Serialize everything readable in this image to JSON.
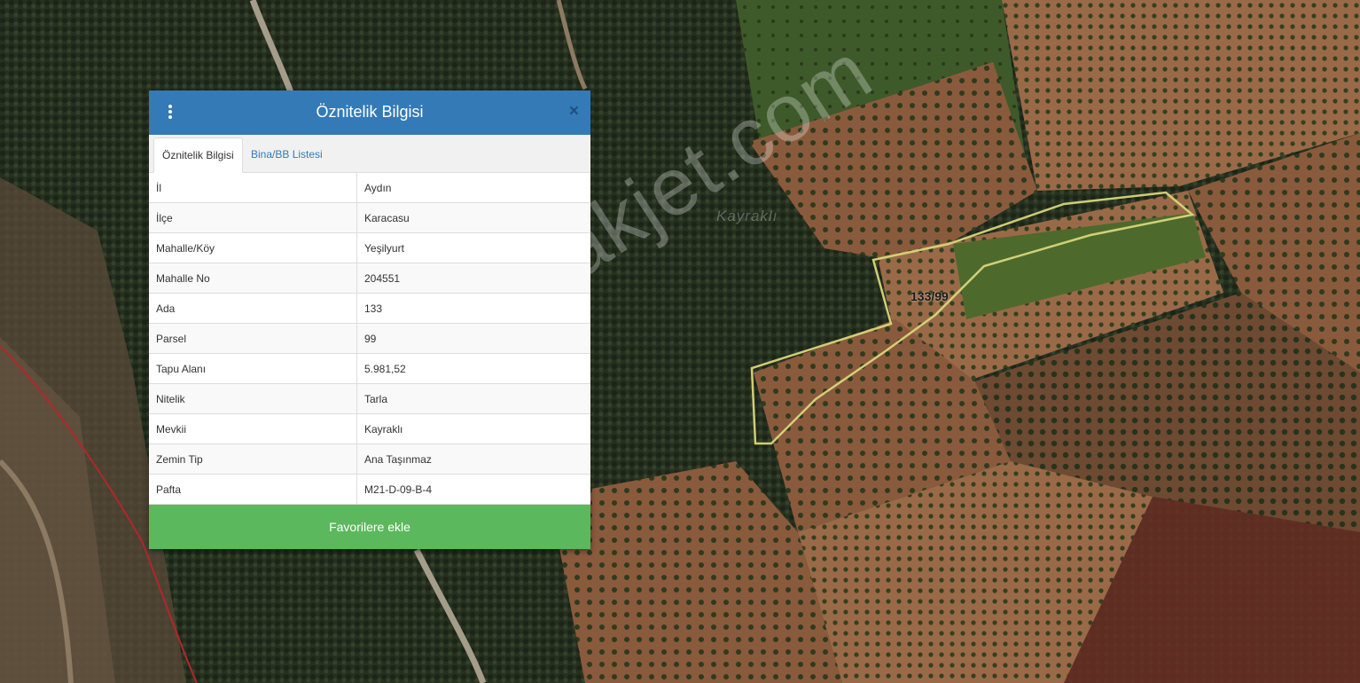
{
  "map": {
    "watermark": "emlakjet.com",
    "faint_label": "Kayraklı",
    "parcel_label": "133/99"
  },
  "panel": {
    "title": "Öznitelik Bilgisi",
    "close_glyph": "×",
    "tabs": [
      {
        "label": "Öznitelik Bilgisi",
        "active": true
      },
      {
        "label": "Bina/BB Listesi",
        "active": false
      }
    ],
    "rows": [
      {
        "key": "İl",
        "value": "Aydın"
      },
      {
        "key": "İlçe",
        "value": "Karacasu"
      },
      {
        "key": "Mahalle/Köy",
        "value": "Yeşilyurt"
      },
      {
        "key": "Mahalle No",
        "value": "204551"
      },
      {
        "key": "Ada",
        "value": "133"
      },
      {
        "key": "Parsel",
        "value": "99"
      },
      {
        "key": "Tapu Alanı",
        "value": "5.981,52"
      },
      {
        "key": "Nitelik",
        "value": "Tarla"
      },
      {
        "key": "Mevkii",
        "value": "Kayraklı"
      },
      {
        "key": "Zemin Tip",
        "value": "Ana Taşınmaz"
      },
      {
        "key": "Pafta",
        "value": "M21-D-09-B-4"
      }
    ],
    "favorite_button": "Favorilere ekle"
  },
  "colors": {
    "header": "#337ab7",
    "favorite_button": "#5cb85c",
    "parcel_outline": "#d8d67a",
    "boundary_line": "#b3262a"
  },
  "icons": {
    "menu": "vertical-dots-icon",
    "close": "close-icon"
  }
}
